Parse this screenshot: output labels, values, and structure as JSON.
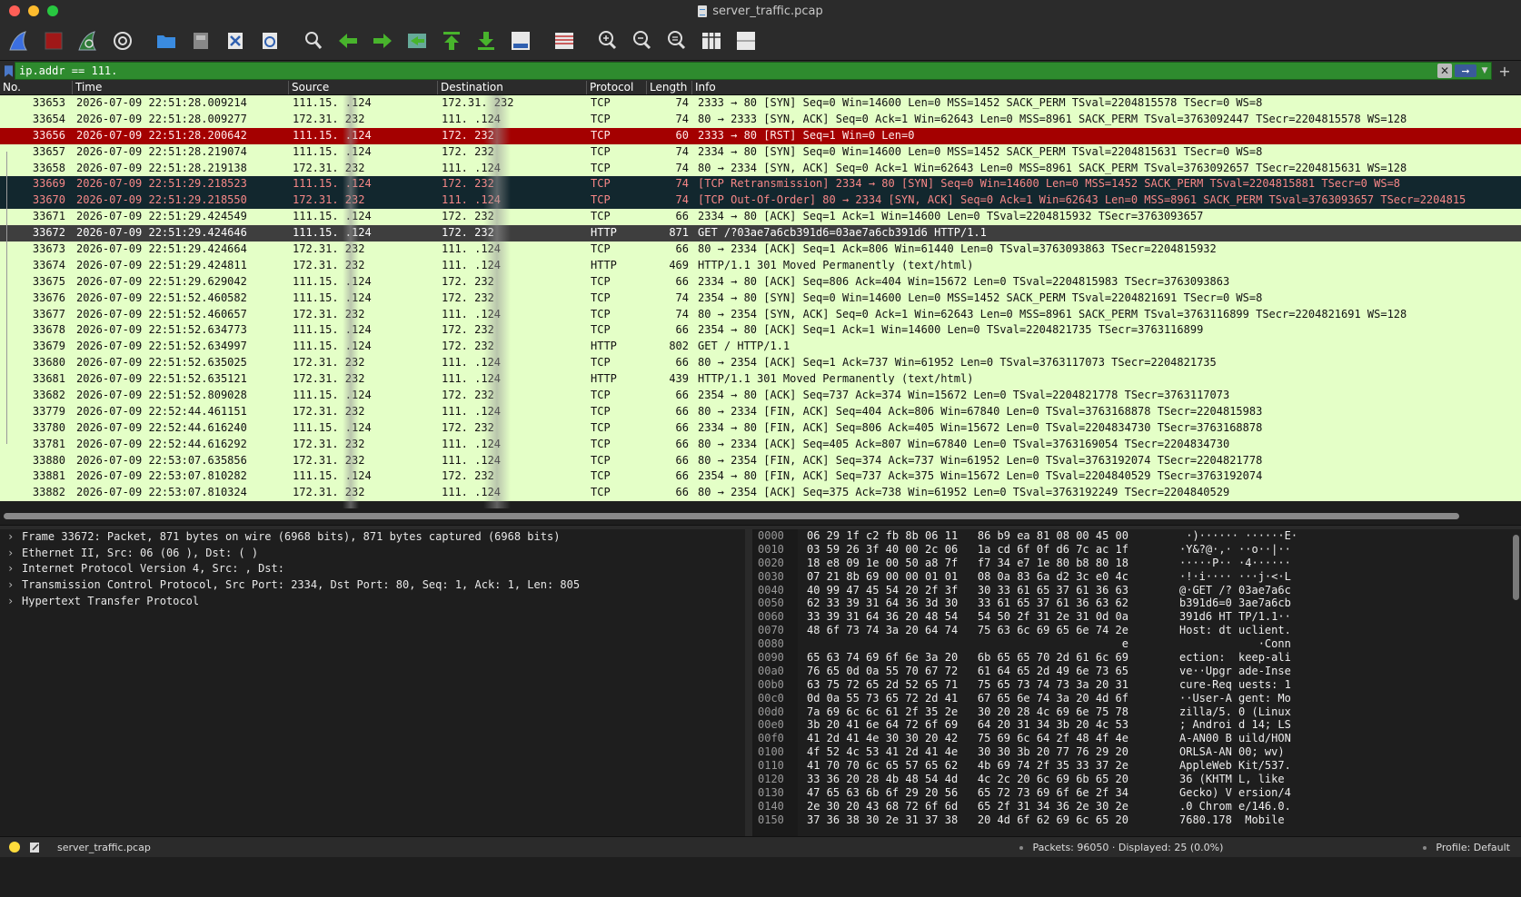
{
  "window": {
    "title": "server_traffic.pcap"
  },
  "filter": {
    "value": "ip.addr == 111.",
    "clear_label": "✕",
    "apply_label": "➞",
    "add_label": "+"
  },
  "columns": [
    "No.",
    "Time",
    "Source",
    "Destination",
    "Protocol",
    "Length",
    "Info"
  ],
  "packets": [
    {
      "no": "33653",
      "time": "2026-07-09 22:51:28.009214",
      "src": "111.15.   .124",
      "dst": "172.31.   232",
      "proto": "TCP",
      "len": "74",
      "info": "2333 → 80 [SYN] Seq=0 Win=14600 Len=0 MSS=1452 SACK_PERM TSval=2204815578 TSecr=0 WS=8",
      "style": "norm"
    },
    {
      "no": "33654",
      "time": "2026-07-09 22:51:28.009277",
      "src": "172.31.   232",
      "dst": "111.   .124",
      "proto": "TCP",
      "len": "74",
      "info": "80 → 2333 [SYN, ACK] Seq=0 Ack=1 Win=62643 Len=0 MSS=8961 SACK_PERM TSval=3763092447 TSecr=2204815578 WS=128",
      "style": "norm"
    },
    {
      "no": "33656",
      "time": "2026-07-09 22:51:28.200642",
      "src": "111.15.   .124",
      "dst": "172.   232",
      "proto": "TCP",
      "len": "60",
      "info": "2333 → 80 [RST] Seq=1 Win=0 Len=0",
      "style": "rst"
    },
    {
      "no": "33657",
      "time": "2026-07-09 22:51:28.219074",
      "src": "111.15.   .124",
      "dst": "172.   232",
      "proto": "TCP",
      "len": "74",
      "info": "2334 → 80 [SYN] Seq=0 Win=14600 Len=0 MSS=1452 SACK_PERM TSval=2204815631 TSecr=0 WS=8",
      "style": "norm"
    },
    {
      "no": "33658",
      "time": "2026-07-09 22:51:28.219138",
      "src": "172.31.   232",
      "dst": "111.   .124",
      "proto": "TCP",
      "len": "74",
      "info": "80 → 2334 [SYN, ACK] Seq=0 Ack=1 Win=62643 Len=0 MSS=8961 SACK_PERM TSval=3763092657 TSecr=2204815631 WS=128",
      "style": "norm"
    },
    {
      "no": "33669",
      "time": "2026-07-09 22:51:29.218523",
      "src": "111.15.   .124",
      "dst": "172.   232",
      "proto": "TCP",
      "len": "74",
      "info": "[TCP Retransmission] 2334 → 80 [SYN] Seq=0 Win=14600 Len=0 MSS=1452 SACK_PERM TSval=2204815881 TSecr=0 WS=8",
      "style": "bad"
    },
    {
      "no": "33670",
      "time": "2026-07-09 22:51:29.218550",
      "src": "172.31.   232",
      "dst": "111.   .124",
      "proto": "TCP",
      "len": "74",
      "info": "[TCP Out-Of-Order] 80 → 2334 [SYN, ACK] Seq=0 Ack=1 Win=62643 Len=0 MSS=8961 SACK_PERM TSval=3763093657 TSecr=2204815",
      "style": "bad"
    },
    {
      "no": "33671",
      "time": "2026-07-09 22:51:29.424549",
      "src": "111.15.   .124",
      "dst": "172.   232",
      "proto": "TCP",
      "len": "66",
      "info": "2334 → 80 [ACK] Seq=1 Ack=1 Win=14600 Len=0 TSval=2204815932 TSecr=3763093657",
      "style": "norm"
    },
    {
      "no": "33672",
      "time": "2026-07-09 22:51:29.424646",
      "src": "111.15.   .124",
      "dst": "172.   232",
      "proto": "HTTP",
      "len": "871",
      "info": "GET /?03ae7a6cb391d6=03ae7a6cb391d6 HTTP/1.1",
      "style": "sel"
    },
    {
      "no": "33673",
      "time": "2026-07-09 22:51:29.424664",
      "src": "172.31.   232",
      "dst": "111.   .124",
      "proto": "TCP",
      "len": "66",
      "info": "80 → 2334 [ACK] Seq=1 Ack=806 Win=61440 Len=0 TSval=3763093863 TSecr=2204815932",
      "style": "norm"
    },
    {
      "no": "33674",
      "time": "2026-07-09 22:51:29.424811",
      "src": "172.31.   232",
      "dst": "111.   .124",
      "proto": "HTTP",
      "len": "469",
      "info": "HTTP/1.1 301 Moved Permanently  (text/html)",
      "style": "norm"
    },
    {
      "no": "33675",
      "time": "2026-07-09 22:51:29.629042",
      "src": "111.15.   .124",
      "dst": "172.   232",
      "proto": "TCP",
      "len": "66",
      "info": "2334 → 80 [ACK] Seq=806 Ack=404 Win=15672 Len=0 TSval=2204815983 TSecr=3763093863",
      "style": "norm"
    },
    {
      "no": "33676",
      "time": "2026-07-09 22:51:52.460582",
      "src": "111.15.   .124",
      "dst": "172.   232",
      "proto": "TCP",
      "len": "74",
      "info": "2354 → 80 [SYN] Seq=0 Win=14600 Len=0 MSS=1452 SACK_PERM TSval=2204821691 TSecr=0 WS=8",
      "style": "norm"
    },
    {
      "no": "33677",
      "time": "2026-07-09 22:51:52.460657",
      "src": "172.31.   232",
      "dst": "111.   .124",
      "proto": "TCP",
      "len": "74",
      "info": "80 → 2354 [SYN, ACK] Seq=0 Ack=1 Win=62643 Len=0 MSS=8961 SACK_PERM TSval=3763116899 TSecr=2204821691 WS=128",
      "style": "norm"
    },
    {
      "no": "33678",
      "time": "2026-07-09 22:51:52.634773",
      "src": "111.15.   .124",
      "dst": "172.   232",
      "proto": "TCP",
      "len": "66",
      "info": "2354 → 80 [ACK] Seq=1 Ack=1 Win=14600 Len=0 TSval=2204821735 TSecr=3763116899",
      "style": "norm"
    },
    {
      "no": "33679",
      "time": "2026-07-09 22:51:52.634997",
      "src": "111.15.   .124",
      "dst": "172.   232",
      "proto": "HTTP",
      "len": "802",
      "info": "GET / HTTP/1.1",
      "style": "norm"
    },
    {
      "no": "33680",
      "time": "2026-07-09 22:51:52.635025",
      "src": "172.31.   232",
      "dst": "111.   .124",
      "proto": "TCP",
      "len": "66",
      "info": "80 → 2354 [ACK] Seq=1 Ack=737 Win=61952 Len=0 TSval=3763117073 TSecr=2204821735",
      "style": "norm"
    },
    {
      "no": "33681",
      "time": "2026-07-09 22:51:52.635121",
      "src": "172.31.   232",
      "dst": "111.   .124",
      "proto": "HTTP",
      "len": "439",
      "info": "HTTP/1.1 301 Moved Permanently  (text/html)",
      "style": "norm"
    },
    {
      "no": "33682",
      "time": "2026-07-09 22:51:52.809028",
      "src": "111.15.   .124",
      "dst": "172.   232",
      "proto": "TCP",
      "len": "66",
      "info": "2354 → 80 [ACK] Seq=737 Ack=374 Win=15672 Len=0 TSval=2204821778 TSecr=3763117073",
      "style": "norm"
    },
    {
      "no": "33779",
      "time": "2026-07-09 22:52:44.461151",
      "src": "172.31.   232",
      "dst": "111.   .124",
      "proto": "TCP",
      "len": "66",
      "info": "80 → 2334 [FIN, ACK] Seq=404 Ack=806 Win=67840 Len=0 TSval=3763168878 TSecr=2204815983",
      "style": "norm"
    },
    {
      "no": "33780",
      "time": "2026-07-09 22:52:44.616240",
      "src": "111.15.   .124",
      "dst": "172.   232",
      "proto": "TCP",
      "len": "66",
      "info": "2334 → 80 [FIN, ACK] Seq=806 Ack=405 Win=15672 Len=0 TSval=2204834730 TSecr=3763168878",
      "style": "norm"
    },
    {
      "no": "33781",
      "time": "2026-07-09 22:52:44.616292",
      "src": "172.31.   232",
      "dst": "111.   .124",
      "proto": "TCP",
      "len": "66",
      "info": "80 → 2334 [ACK] Seq=405 Ack=807 Win=67840 Len=0 TSval=3763169054 TSecr=2204834730",
      "style": "norm"
    },
    {
      "no": "33880",
      "time": "2026-07-09 22:53:07.635856",
      "src": "172.31.   232",
      "dst": "111.   .124",
      "proto": "TCP",
      "len": "66",
      "info": "80 → 2354 [FIN, ACK] Seq=374 Ack=737 Win=61952 Len=0 TSval=3763192074 TSecr=2204821778",
      "style": "norm"
    },
    {
      "no": "33881",
      "time": "2026-07-09 22:53:07.810282",
      "src": "111.15.   .124",
      "dst": "172.   232",
      "proto": "TCP",
      "len": "66",
      "info": "2354 → 80 [FIN, ACK] Seq=737 Ack=375 Win=15672 Len=0 TSval=2204840529 TSecr=3763192074",
      "style": "norm"
    },
    {
      "no": "33882",
      "time": "2026-07-09 22:53:07.810324",
      "src": "172.31.   232",
      "dst": "111.   .124",
      "proto": "TCP",
      "len": "66",
      "info": "80 → 2354 [ACK] Seq=375 Ack=738 Win=61952 Len=0 TSval=3763192249 TSecr=2204840529",
      "style": "norm"
    }
  ],
  "details": [
    {
      "text": "Frame 33672: Packet, 871 bytes on wire (6968 bits), 871 bytes captured (6968 bits)"
    },
    {
      "text": "Ethernet II, Src: 06                (06               ), Dst:                   (               )"
    },
    {
      "text": "Internet Protocol Version 4, Src:               , Dst:               "
    },
    {
      "text": "Transmission Control Protocol, Src Port: 2334, Dst Port: 80, Seq: 1, Ack: 1, Len: 805"
    },
    {
      "text": "Hypertext Transfer Protocol"
    }
  ],
  "bytes": [
    {
      "off": "0000",
      "hex": "06 29 1f c2 fb 8b 06 11   86 b9 ea 81 08 00 45 00",
      "ascii": " ·)······ ······E·"
    },
    {
      "off": "0010",
      "hex": "03 59 26 3f 40 00 2c 06   1a cd 6f 0f d6 7c ac 1f",
      "ascii": "·Y&?@·,· ··o··|··"
    },
    {
      "off": "0020",
      "hex": "18 e8 09 1e 00 50 a8 7f   f7 34 e7 1e 80 b8 80 18",
      "ascii": "·····P·· ·4······"
    },
    {
      "off": "0030",
      "hex": "07 21 8b 69 00 00 01 01   08 0a 83 6a d2 3c e0 4c",
      "ascii": "·!·i···· ···j·<·L"
    },
    {
      "off": "0040",
      "hex": "40 99 47 45 54 20 2f 3f   30 33 61 65 37 61 36 63",
      "ascii": "@·GET /? 03ae7a6c"
    },
    {
      "off": "0050",
      "hex": "62 33 39 31 64 36 3d 30   33 61 65 37 61 36 63 62",
      "ascii": "b391d6=0 3ae7a6cb"
    },
    {
      "off": "0060",
      "hex": "33 39 31 64 36 20 48 54   54 50 2f 31 2e 31 0d 0a",
      "ascii": "391d6 HT TP/1.1··"
    },
    {
      "off": "0070",
      "hex": "48 6f 73 74 3a 20 64 74   75 63 6c 69 65 6e 74 2e",
      "ascii": "Host: dt uclient."
    },
    {
      "off": "0080",
      "hex": "                                                e",
      "ascii": "            ·Conn"
    },
    {
      "off": "0090",
      "hex": "65 63 74 69 6f 6e 3a 20   6b 65 65 70 2d 61 6c 69",
      "ascii": "ection:  keep-ali"
    },
    {
      "off": "00a0",
      "hex": "76 65 0d 0a 55 70 67 72   61 64 65 2d 49 6e 73 65",
      "ascii": "ve··Upgr ade-Inse"
    },
    {
      "off": "00b0",
      "hex": "63 75 72 65 2d 52 65 71   75 65 73 74 73 3a 20 31",
      "ascii": "cure-Req uests: 1"
    },
    {
      "off": "00c0",
      "hex": "0d 0a 55 73 65 72 2d 41   67 65 6e 74 3a 20 4d 6f",
      "ascii": "··User-A gent: Mo"
    },
    {
      "off": "00d0",
      "hex": "7a 69 6c 6c 61 2f 35 2e   30 20 28 4c 69 6e 75 78",
      "ascii": "zilla/5. 0 (Linux"
    },
    {
      "off": "00e0",
      "hex": "3b 20 41 6e 64 72 6f 69   64 20 31 34 3b 20 4c 53",
      "ascii": "; Androi d 14; LS"
    },
    {
      "off": "00f0",
      "hex": "41 2d 41 4e 30 30 20 42   75 69 6c 64 2f 48 4f 4e",
      "ascii": "A-AN00 B uild/HON"
    },
    {
      "off": "0100",
      "hex": "4f 52 4c 53 41 2d 41 4e   30 30 3b 20 77 76 29 20",
      "ascii": "ORLSA-AN 00; wv) "
    },
    {
      "off": "0110",
      "hex": "41 70 70 6c 65 57 65 62   4b 69 74 2f 35 33 37 2e",
      "ascii": "AppleWeb Kit/537."
    },
    {
      "off": "0120",
      "hex": "33 36 20 28 4b 48 54 4d   4c 2c 20 6c 69 6b 65 20",
      "ascii": "36 (KHTM L, like "
    },
    {
      "off": "0130",
      "hex": "47 65 63 6b 6f 29 20 56   65 72 73 69 6f 6e 2f 34",
      "ascii": "Gecko) V ersion/4"
    },
    {
      "off": "0140",
      "hex": "2e 30 20 43 68 72 6f 6d   65 2f 31 34 36 2e 30 2e",
      "ascii": ".0 Chrom e/146.0."
    },
    {
      "off": "0150",
      "hex": "37 36 38 30 2e 31 37 38   20 4d 6f 62 69 6c 65 20",
      "ascii": "7680.178  Mobile "
    }
  ],
  "status": {
    "file": "server_traffic.pcap",
    "packets": "Packets: 96050 · Displayed: 25 (0.0%)",
    "profile": "Profile: Default"
  }
}
